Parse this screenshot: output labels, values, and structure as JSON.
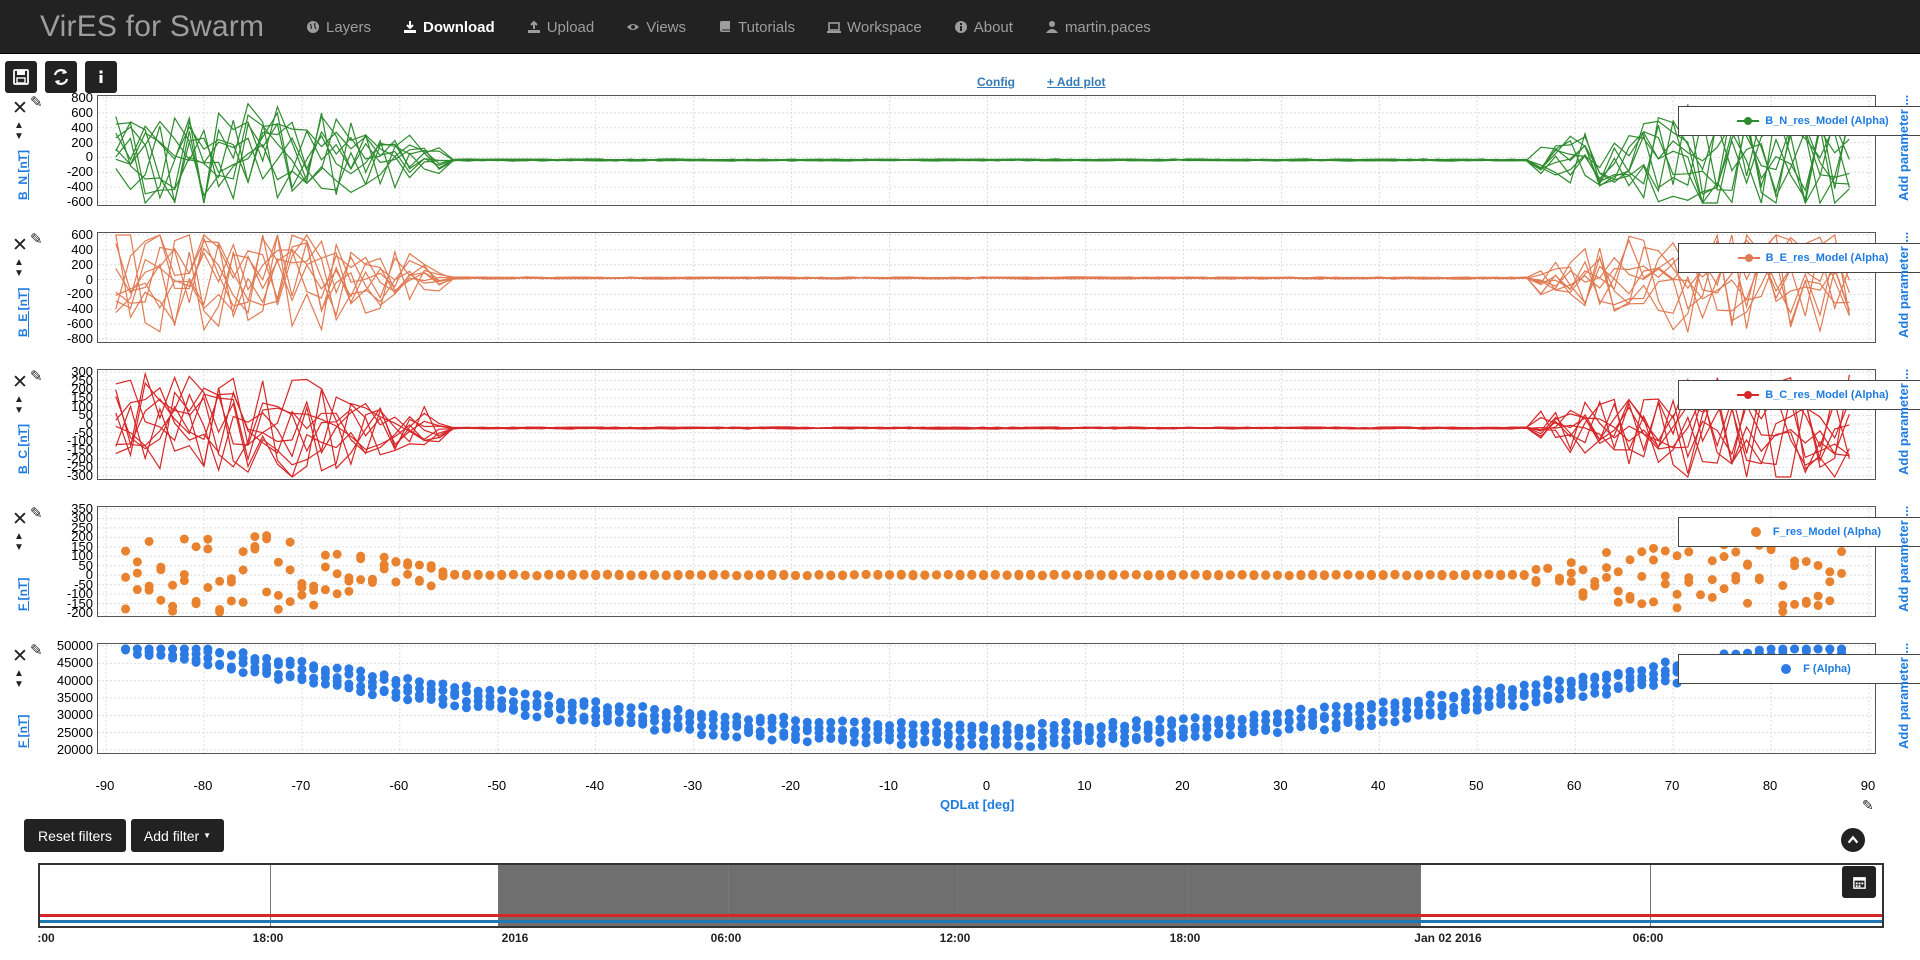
{
  "app": {
    "brand": "VirES for Swarm"
  },
  "nav": {
    "items": [
      {
        "label": "Layers",
        "icon": "globe-icon"
      },
      {
        "label": "Download",
        "icon": "download-icon",
        "active": true
      },
      {
        "label": "Upload",
        "icon": "upload-icon"
      },
      {
        "label": "Views",
        "icon": "eye-icon"
      },
      {
        "label": "Tutorials",
        "icon": "book-icon"
      },
      {
        "label": "Workspace",
        "icon": "laptop-icon"
      },
      {
        "label": "About",
        "icon": "info-circle-icon"
      },
      {
        "label": "martin.paces",
        "icon": "user-icon"
      }
    ]
  },
  "toolbar": {
    "config_label": "Config",
    "add_plot_label": "+ Add plot"
  },
  "plots": [
    {
      "ylabel": "B_N [nT]",
      "yticks": [
        "800",
        "600",
        "400",
        "200",
        "0",
        "-200",
        "-400",
        "-600"
      ],
      "legend": "B_N_res_Model (Alpha)",
      "color": "#2e8b2e",
      "marker": "line",
      "add_parameter": "Add parameter ..."
    },
    {
      "ylabel": "B_E [nT]",
      "yticks": [
        "600",
        "400",
        "200",
        "0",
        "-200",
        "-400",
        "-600",
        "-800"
      ],
      "legend": "B_E_res_Model (Alpha)",
      "color": "#e07b54",
      "marker": "line",
      "add_parameter": "Add parameter ..."
    },
    {
      "ylabel": "B_C [nT]",
      "yticks": [
        "300",
        "250",
        "200",
        "150",
        "100",
        "50",
        "0",
        "-50",
        "-100",
        "-150",
        "-200",
        "-250",
        "-300"
      ],
      "legend": "B_C_res_Model (Alpha)",
      "color": "#d62728",
      "marker": "line",
      "add_parameter": "Add parameter ..."
    },
    {
      "ylabel": "F [nT]",
      "yticks": [
        "350",
        "300",
        "250",
        "200",
        "150",
        "100",
        "50",
        "0",
        "-50",
        "-100",
        "-150",
        "-200"
      ],
      "legend": "F_res_Model (Alpha)",
      "color": "#e8822e",
      "marker": "dot",
      "add_parameter": "Add parameter ..."
    },
    {
      "ylabel": "F [nT]",
      "yticks": [
        "50000",
        "45000",
        "40000",
        "35000",
        "30000",
        "25000",
        "20000"
      ],
      "legend": "F (Alpha)",
      "color": "#2c7be5",
      "marker": "dot",
      "add_parameter": "Add parameter ..."
    }
  ],
  "xaxis": {
    "label": "QDLat [deg]",
    "ticks": [
      "-90",
      "-80",
      "-70",
      "-60",
      "-50",
      "-40",
      "-30",
      "-20",
      "-10",
      "0",
      "10",
      "20",
      "30",
      "40",
      "50",
      "60",
      "70",
      "80",
      "90"
    ]
  },
  "filters": {
    "reset_label": "Reset filters",
    "add_label": "Add filter"
  },
  "timeline": {
    "ticks": [
      ":00",
      "18:00",
      "2016",
      "06:00",
      "12:00",
      "18:00",
      "Jan 02 2016",
      "06:00"
    ],
    "line_colors": [
      "#d62728",
      "#1f77b4"
    ]
  }
}
